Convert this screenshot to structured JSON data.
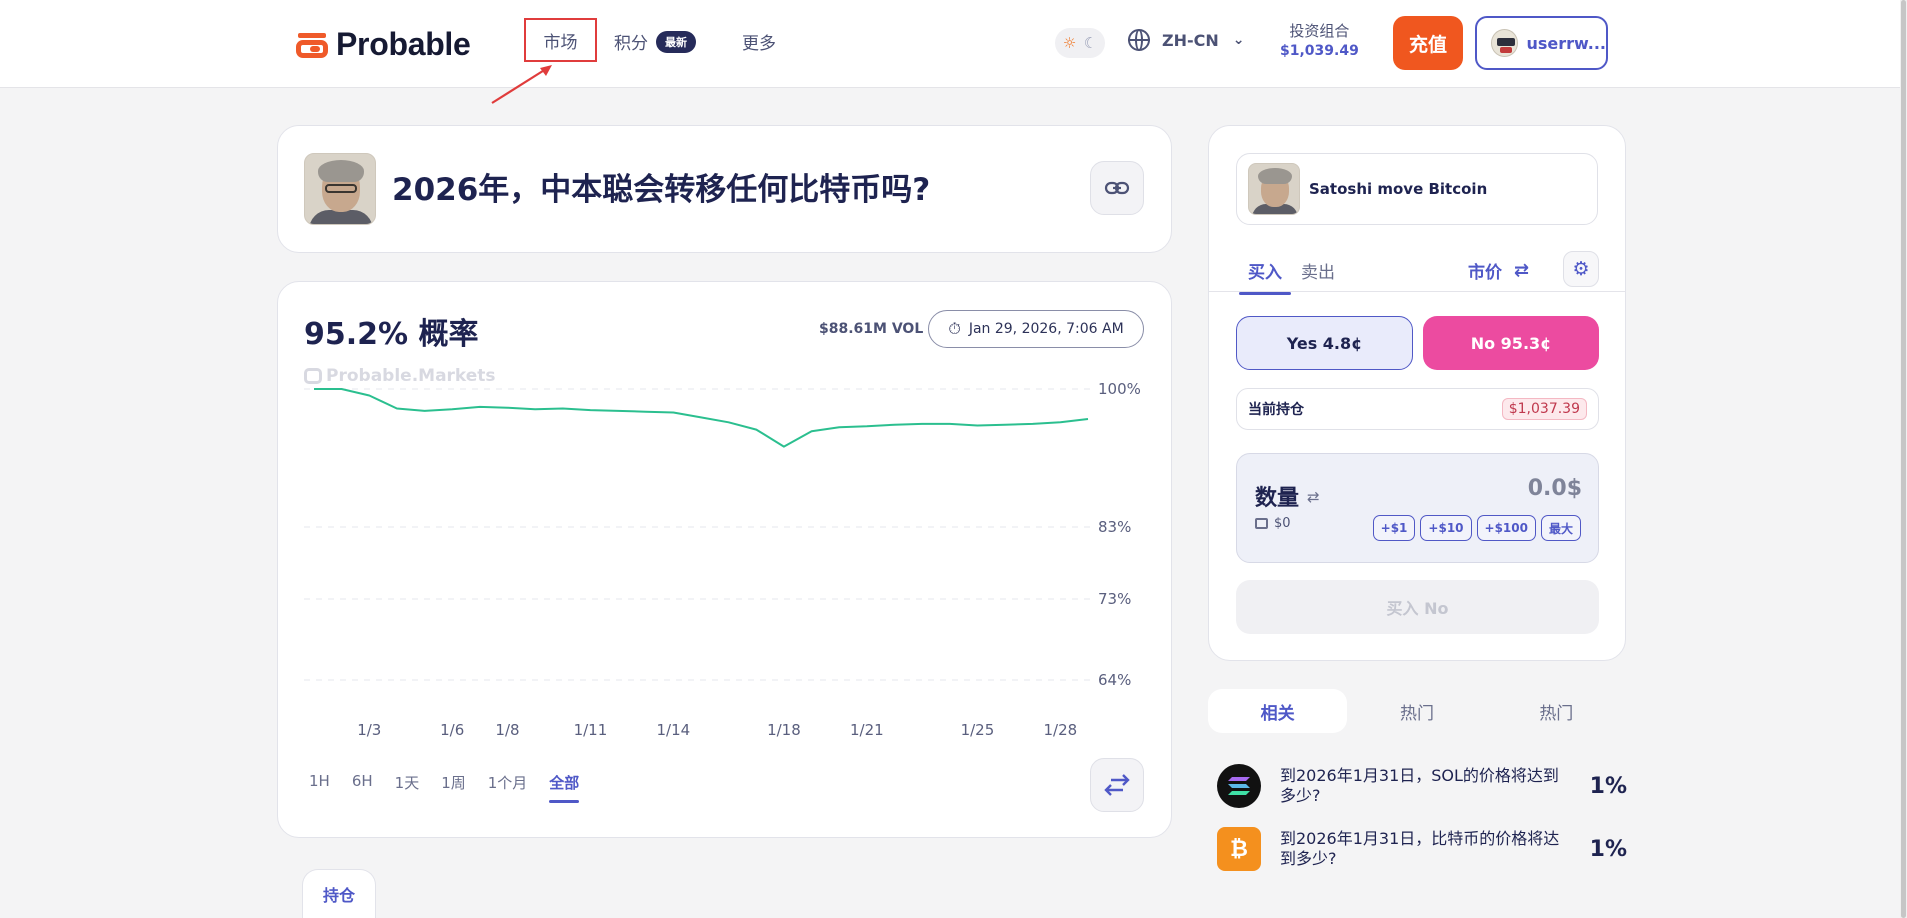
{
  "header": {
    "logo_text": "Probable",
    "nav": {
      "market": "市场",
      "points": "积分",
      "points_badge": "最新",
      "more": "更多"
    },
    "lang": "ZH-CN",
    "portfolio_label": "投资组合",
    "portfolio_value": "$1,039.49",
    "deposit_label": "充值",
    "username": "userrw..."
  },
  "market": {
    "title": "2026年，中本聪会转移任何比特币吗?",
    "probability": "95.2% 概率",
    "volume": "$88.61M VOL",
    "date": "Jan 29, 2026, 7:06 AM",
    "watermark": "Probable.Markets"
  },
  "chart_data": {
    "type": "line",
    "x": [
      "1/1",
      "1/2",
      "1/3",
      "1/4",
      "1/5",
      "1/6",
      "1/7",
      "1/8",
      "1/9",
      "1/10",
      "1/11",
      "1/12",
      "1/13",
      "1/14",
      "1/15",
      "1/16",
      "1/17",
      "1/18",
      "1/19",
      "1/20",
      "1/21",
      "1/22",
      "1/23",
      "1/24",
      "1/25",
      "1/26",
      "1/27",
      "1/28",
      "1/29"
    ],
    "y_values": [
      100,
      100,
      99.2,
      97.6,
      97.3,
      97.5,
      97.8,
      97.7,
      97.5,
      97.6,
      97.4,
      97.3,
      97.2,
      97.1,
      96.5,
      95.9,
      95.0,
      92.9,
      94.8,
      95.3,
      95.4,
      95.6,
      95.7,
      95.7,
      95.5,
      95.6,
      95.7,
      95.9,
      96.3
    ],
    "x_tick_labels": [
      "1/3",
      "1/6",
      "1/8",
      "1/11",
      "1/14",
      "1/18",
      "1/21",
      "1/25",
      "1/28"
    ],
    "y_tick_labels": [
      "100%",
      "83%",
      "73%",
      "64%"
    ],
    "y_ticks": [
      100,
      83,
      73,
      64
    ],
    "ylim": [
      60,
      100
    ],
    "line_color": "#2bbf8f",
    "grid": true,
    "title": "",
    "xlabel": "",
    "ylabel": ""
  },
  "range_tabs": [
    "1H",
    "6H",
    "1天",
    "1周",
    "1个月",
    "全部"
  ],
  "active_range": "全部",
  "holdings_tab": "持仓",
  "trade": {
    "market_name": "Satoshi move Bitcoin",
    "tab_buy": "买入",
    "tab_sell": "卖出",
    "order_type": "市价",
    "yes_label": "Yes 4.8¢",
    "no_label": "No 95.3¢",
    "position_label": "当前持仓",
    "position_value": "$1,037.39",
    "amount_label": "数量",
    "balance": "$0",
    "amount_value": "0.0$",
    "quick": [
      "+$1",
      "+$10",
      "+$100",
      "最大"
    ],
    "submit_label": "买入 No"
  },
  "related": {
    "tabs": [
      "相关",
      "热门",
      "热门"
    ],
    "items": [
      {
        "text": "到2026年1月31日，SOL的价格将达到多少?",
        "pct": "1%",
        "icon": "solana-icon"
      },
      {
        "text": "到2026年1月31日，比特币的价格将达到多少?",
        "pct": "1%",
        "icon": "bitcoin-icon"
      }
    ]
  },
  "colors": {
    "accent": "#4f58c7",
    "brand": "#f0571f",
    "no": "#ec4ba0",
    "line": "#2bbf8f"
  }
}
